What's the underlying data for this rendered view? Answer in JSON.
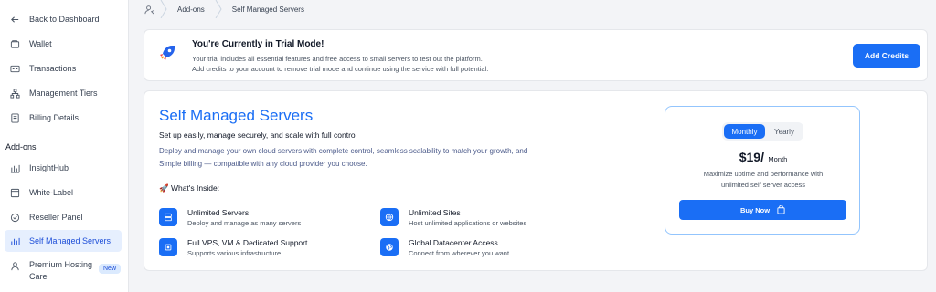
{
  "sidebar": {
    "back": "Back to Dashboard",
    "items": [
      {
        "label": "Wallet",
        "icon": "wallet-icon"
      },
      {
        "label": "Transactions",
        "icon": "transactions-icon"
      },
      {
        "label": "Management Tiers",
        "icon": "tiers-icon"
      },
      {
        "label": "Billing Details",
        "icon": "billing-icon"
      }
    ],
    "section": "Add-ons",
    "addons": [
      {
        "label": "InsightHub",
        "icon": "chart-icon"
      },
      {
        "label": "White-Label",
        "icon": "window-icon"
      },
      {
        "label": "Reseller Panel",
        "icon": "badge-check-icon"
      },
      {
        "label": "Self Managed Servers",
        "icon": "servers-icon"
      },
      {
        "label_line1": "Premium Hosting",
        "label_line2": "Care",
        "icon": "care-icon",
        "badge": "New"
      }
    ]
  },
  "breadcrumb": {
    "items": [
      "Add-ons",
      "Self Managed Servers"
    ]
  },
  "trial": {
    "title": "You're Currently in Trial Mode!",
    "line1": "Your trial includes all essential features and free access to small servers to test out the platform.",
    "line2": "Add credits to your account to remove trial mode and continue using the service with full potential.",
    "button": "Add Credits"
  },
  "card": {
    "title": "Self Managed Servers",
    "subtitle": "Set up easily, manage securely, and scale with full control",
    "desc1": "Deploy and manage your own cloud servers with complete control, seamless scalability to match your growth, and",
    "desc2": "Simple billing — compatible with any cloud provider you choose.",
    "inside": "🚀 What's Inside:",
    "features": [
      {
        "title": "Unlimited Servers",
        "desc": "Deploy and manage as many servers",
        "icon": "server-icon"
      },
      {
        "title": "Unlimited Sites",
        "desc": "Host unlimited applications or websites",
        "icon": "globe-icon"
      },
      {
        "title": "Full VPS, VM & Dedicated Support",
        "desc": "Supports various infrastructure",
        "icon": "chip-icon"
      },
      {
        "title": "Global Datacenter Access",
        "desc": "Connect from wherever you want",
        "icon": "world-icon"
      }
    ]
  },
  "pricing": {
    "monthly": "Monthly",
    "yearly": "Yearly",
    "amount": "$19/",
    "unit": "Month",
    "desc1": "Maximize uptime and performance with",
    "desc2": "unlimited self server access",
    "button": "Buy Now"
  },
  "colors": {
    "accent": "#1a6ef5",
    "active_bg": "#e6effe"
  }
}
